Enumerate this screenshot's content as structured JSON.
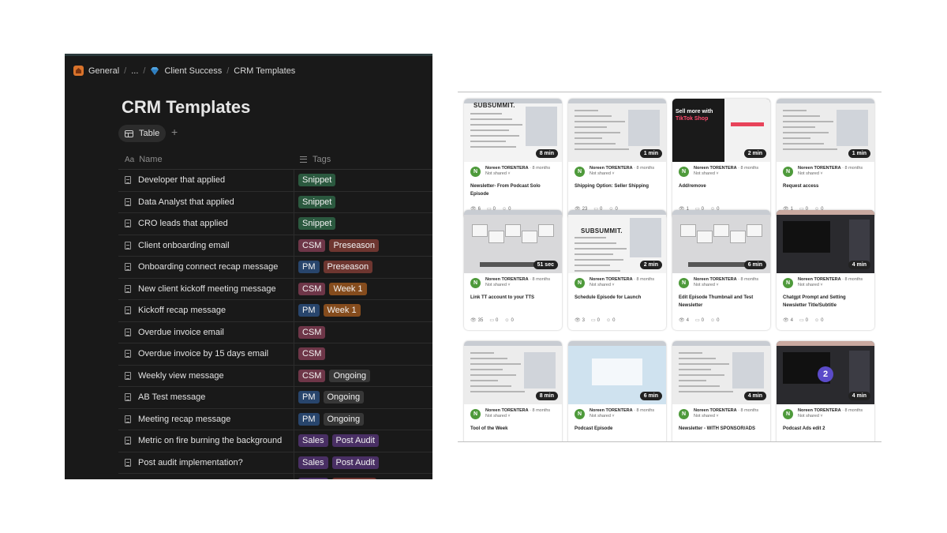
{
  "notion": {
    "breadcrumb": [
      "General",
      "...",
      "Client Success",
      "CRM Templates"
    ],
    "title": "CRM Templates",
    "view_tab": "Table",
    "add_view": "+",
    "columns": {
      "name": "Name",
      "name_icon": "Aa",
      "tags": "Tags"
    },
    "rows": [
      {
        "name": "Developer that applied",
        "tags": [
          {
            "label": "Snippet",
            "color": "#2b593f"
          }
        ]
      },
      {
        "name": "Data Analyst that applied",
        "tags": [
          {
            "label": "Snippet",
            "color": "#2b593f"
          }
        ]
      },
      {
        "name": "CRO leads that applied",
        "tags": [
          {
            "label": "Snippet",
            "color": "#2b593f"
          }
        ]
      },
      {
        "name": "Client onboarding email",
        "tags": [
          {
            "label": "CSM",
            "color": "#6e3648"
          },
          {
            "label": "Preseason",
            "color": "#6e3630"
          }
        ]
      },
      {
        "name": "Onboarding connect recap message",
        "tags": [
          {
            "label": "PM",
            "color": "#28456c"
          },
          {
            "label": "Preseason",
            "color": "#6e3630"
          }
        ]
      },
      {
        "name": "New client kickoff meeting message",
        "tags": [
          {
            "label": "CSM",
            "color": "#6e3648"
          },
          {
            "label": "Week 1",
            "color": "#854c1d"
          }
        ]
      },
      {
        "name": "Kickoff recap message",
        "tags": [
          {
            "label": "PM",
            "color": "#28456c"
          },
          {
            "label": "Week 1",
            "color": "#854c1d"
          }
        ]
      },
      {
        "name": "Overdue invoice email",
        "tags": [
          {
            "label": "CSM",
            "color": "#6e3648"
          }
        ]
      },
      {
        "name": "Overdue invoice by 15 days email",
        "tags": [
          {
            "label": "CSM",
            "color": "#6e3648"
          }
        ]
      },
      {
        "name": "Weekly view message",
        "tags": [
          {
            "label": "CSM",
            "color": "#6e3648"
          },
          {
            "label": "Ongoing",
            "color": "#373737"
          }
        ]
      },
      {
        "name": "AB Test message",
        "tags": [
          {
            "label": "PM",
            "color": "#28456c"
          },
          {
            "label": "Ongoing",
            "color": "#373737"
          }
        ]
      },
      {
        "name": "Meeting recap message",
        "tags": [
          {
            "label": "PM",
            "color": "#28456c"
          },
          {
            "label": "Ongoing",
            "color": "#373737"
          }
        ]
      },
      {
        "name": "Metric on fire burning the background",
        "tags": [
          {
            "label": "Sales",
            "color": "#492f64"
          },
          {
            "label": "Post Audit",
            "color": "#492f64"
          }
        ]
      },
      {
        "name": "Post audit implementation?",
        "tags": [
          {
            "label": "Sales",
            "color": "#492f64"
          },
          {
            "label": "Post Audit",
            "color": "#492f64"
          }
        ]
      },
      {
        "name": "",
        "tags": [
          {
            "label": "",
            "color": "#492f64"
          },
          {
            "label": "",
            "color": "#6e3630"
          }
        ]
      }
    ]
  },
  "videos": {
    "author": "Noreen TORENTERA",
    "ago": "· 8 months",
    "shared": "Not shared ˅",
    "avatar_letter": "N",
    "cards": [
      {
        "title": "Newsletter- From Podcast Solo Episode",
        "duration": "8 min",
        "views": "6",
        "comments": "0",
        "reactions": "0",
        "thumb": "subsummit"
      },
      {
        "title": "Shipping Option: Seller Shipping",
        "duration": "1 min",
        "views": "23",
        "comments": "0",
        "reactions": "0",
        "thumb": "screen"
      },
      {
        "title": "Add/remove",
        "duration": "2 min",
        "views": "1",
        "comments": "0",
        "reactions": "0",
        "thumb": "promo"
      },
      {
        "title": "Request access",
        "duration": "1 min",
        "views": "1",
        "comments": "0",
        "reactions": "0",
        "thumb": "screen"
      },
      {
        "title": "Link TT account to your TTS",
        "duration": "51 sec",
        "views": "35",
        "comments": "0",
        "reactions": "0",
        "thumb": "desktop"
      },
      {
        "title": "Schedule Episode for Launch",
        "duration": "2 min",
        "views": "3",
        "comments": "0",
        "reactions": "0",
        "thumb": "subsummit2"
      },
      {
        "title": "Edit Episode Thumbnail and Test Newsletter",
        "duration": "6 min",
        "views": "4",
        "comments": "0",
        "reactions": "0",
        "thumb": "desktop"
      },
      {
        "title": "Chatgpt Prompt and Setting Newsletter Title/Subtitle",
        "duration": "4 min",
        "views": "4",
        "comments": "0",
        "reactions": "0",
        "thumb": "dark"
      },
      {
        "title": "Tool of the Week",
        "duration": "8 min",
        "views": "",
        "comments": "",
        "reactions": "",
        "thumb": "screen"
      },
      {
        "title": "Podcast Episode",
        "duration": "6 min",
        "views": "",
        "comments": "",
        "reactions": "",
        "thumb": "blue"
      },
      {
        "title": "Newsletter - WITH SPONSOR/ADS",
        "duration": "4 min",
        "views": "",
        "comments": "",
        "reactions": "",
        "thumb": "screen"
      },
      {
        "title": "Podcast Ads edit 2",
        "duration": "4 min",
        "views": "",
        "comments": "",
        "reactions": "",
        "thumb": "dark2"
      }
    ],
    "thumb_texts": {
      "subsummit": "SUBSUMMIT.",
      "promo_line1": "Sell more with",
      "promo_line2": "TikTok Shop",
      "badge": "2"
    }
  }
}
